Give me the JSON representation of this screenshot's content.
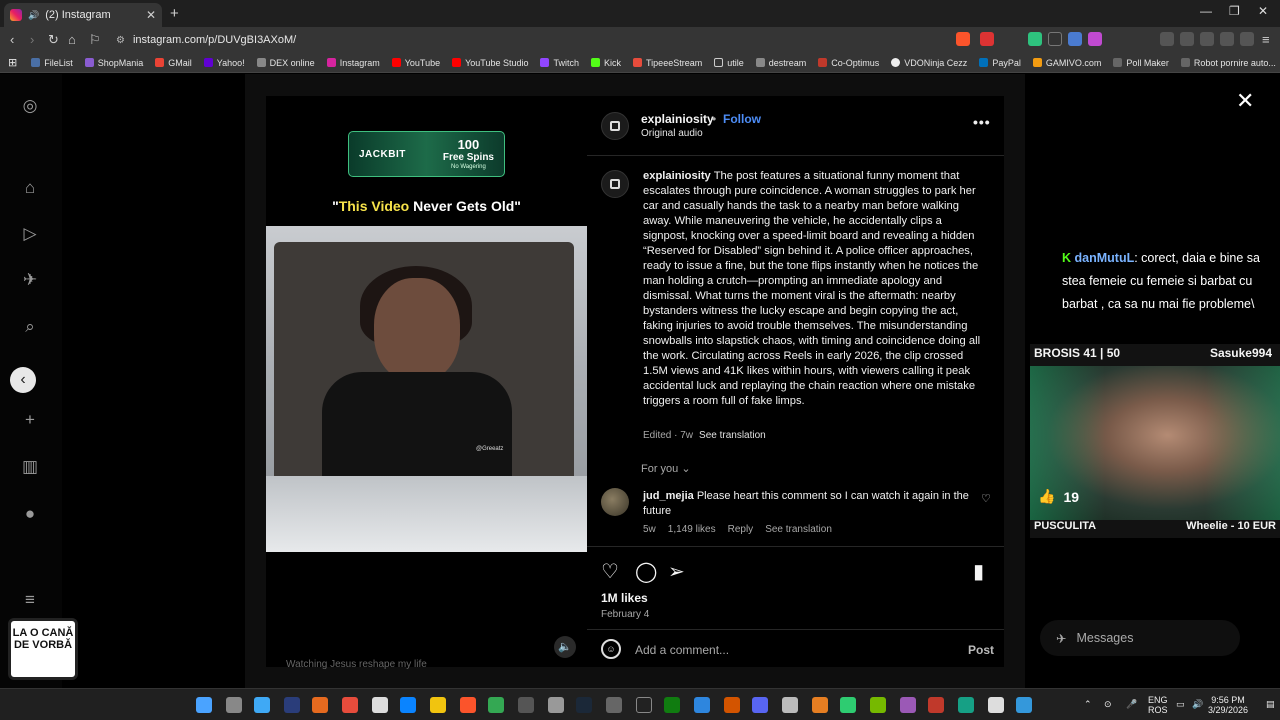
{
  "browser": {
    "tab_title": "(2) Instagram",
    "url": "instagram.com/p/DUVgBI3AXoM/",
    "bookmarks": [
      "FileList",
      "ShopMania",
      "GMail",
      "Yahoo!",
      "DEX online",
      "Instagram",
      "YouTube",
      "YouTube Studio",
      "Twitch",
      "Kick",
      "TipeeeStream",
      "utile",
      "destream",
      "Co-Optimus",
      "VDONinja Cezz",
      "PayPal",
      "GAMIVO.com",
      "Poll Maker",
      "Robot pornire auto..."
    ]
  },
  "post": {
    "username": "explainiosity",
    "follow_label": "Follow",
    "audio": "Original audio",
    "caption_user": "explainiosity",
    "caption_text": "The post features a situational funny moment that escalates through pure coincidence. A woman struggles to park her car and casually hands the task to a nearby man before walking away. While maneuvering the vehicle, he accidentally clips a signpost, knocking over a speed-limit board and revealing a hidden “Reserved for Disabled” sign behind it. A police officer approaches, ready to issue a fine, but the tone flips instantly when he notices the man holding a crutch—prompting an immediate apology and dismissal. What turns the moment viral is the aftermath: nearby bystanders witness the lucky escape and begin copying the act, faking injuries to avoid trouble themselves. The misunderstanding snowballs into slapstick chaos, with timing and coincidence doing all the work. Circulating across Reels in early 2026, the clip crossed 1.5M views and 41K likes within hours, with viewers calling it peak accidental luck and replaying the chain reaction where one mistake triggers a room full of fake limps.",
    "edited": "Edited · 7w",
    "see_translation": "See translation",
    "for_you": "For you",
    "comment": {
      "user": "jud_mejia",
      "text": "Please heart this comment so I can watch it again in the future",
      "age": "5w",
      "likes": "1,149 likes",
      "reply": "Reply",
      "see_translation": "See translation"
    },
    "likes": "1M likes",
    "date": "February 4",
    "add_comment_placeholder": "Add a comment...",
    "post_label": "Post"
  },
  "video": {
    "banner_brand": "JACKBIT",
    "banner_big": "100",
    "banner_mid": "Free Spins",
    "banner_small": "No Wagering",
    "caption_open": "\"",
    "caption_highlight": "This Video",
    "caption_rest": " Never Gets Old\"",
    "watermark": "@Greeatz",
    "bottom_text": "Watching Jesus reshape my life"
  },
  "stream": {
    "chat_nick": "danMutuL",
    "chat_text": ": corect, daia e bine sa stea femeie cu femeie si barbat cu barbat , ca sa nu mai fie probleme\\",
    "cam_left": "BROSIS 41 | 50",
    "cam_right": "Sasuke994",
    "thumb_count": "19",
    "foot_left": "PUSCULITA",
    "foot_right": "Wheelie - 10 EUR",
    "messages": "Messages",
    "mug_text": "LA O CANĂ DE VORBĂ"
  },
  "taskbar": {
    "lang_top": "ENG",
    "lang_bottom": "ROS",
    "time": "9:56 PM",
    "date": "3/29/2026"
  }
}
